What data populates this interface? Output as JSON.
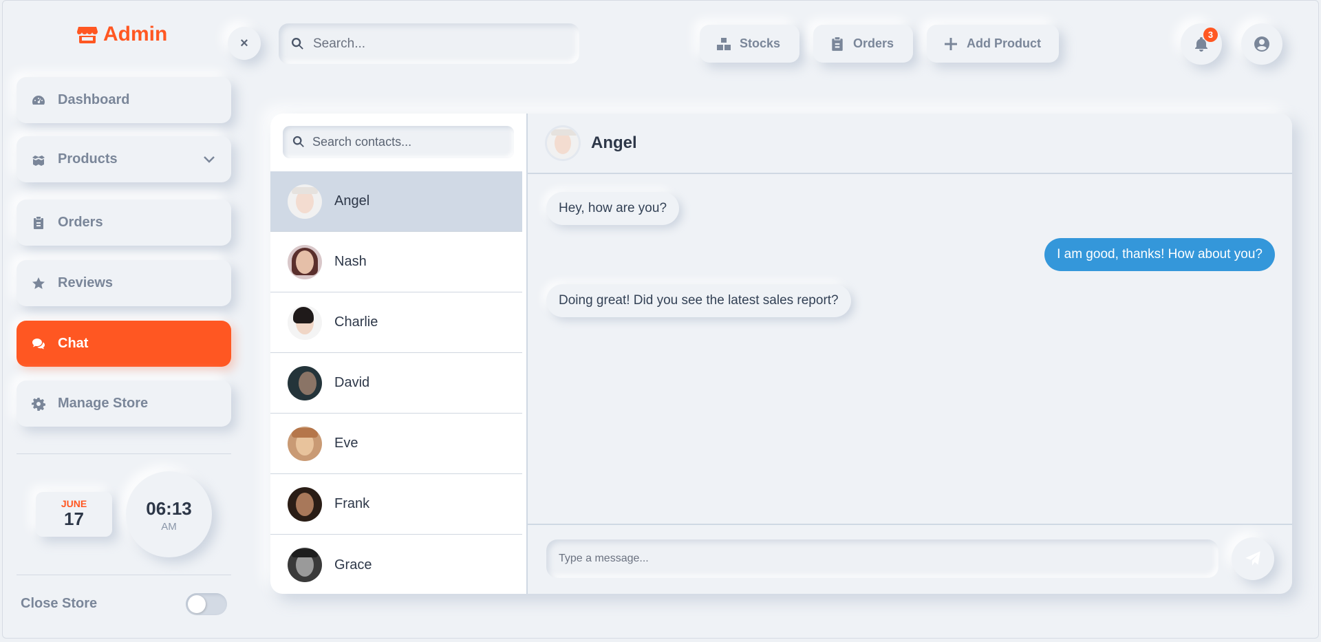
{
  "brand": {
    "name": "Admin",
    "icon": "store-icon",
    "color": "#ff5722"
  },
  "sidebar": {
    "items": [
      {
        "label": "Dashboard",
        "icon": "gauge-icon"
      },
      {
        "label": "Products",
        "icon": "boxes-icon"
      },
      {
        "label": "Orders",
        "icon": "clipboard-icon"
      },
      {
        "label": "Reviews",
        "icon": "star-icon"
      },
      {
        "label": "Chat",
        "icon": "comments-icon",
        "active": true
      },
      {
        "label": "Manage Store",
        "icon": "gear-icon"
      }
    ],
    "date": {
      "month": "JUNE",
      "day": "17"
    },
    "clock": {
      "time": "06:13",
      "ampm": "AM"
    },
    "close_store_label": "Close Store",
    "close_store_on": false
  },
  "header": {
    "close_label": "×",
    "search_placeholder": "Search...",
    "buttons": [
      {
        "label": "Stocks",
        "icon": "cubes-icon"
      },
      {
        "label": "Orders",
        "icon": "clipboard-icon"
      },
      {
        "label": "Add Product",
        "icon": "plus-icon"
      }
    ],
    "notifications_count": "3",
    "user_icon": "user-circle-icon"
  },
  "contacts": {
    "search_placeholder": "Search contacts...",
    "list": [
      {
        "name": "Angel",
        "active": true
      },
      {
        "name": "Nash"
      },
      {
        "name": "Charlie"
      },
      {
        "name": "David"
      },
      {
        "name": "Eve"
      },
      {
        "name": "Frank"
      },
      {
        "name": "Grace"
      }
    ]
  },
  "conversation": {
    "contact_name": "Angel",
    "messages": [
      {
        "text": "Hey, how are you?",
        "direction": "in"
      },
      {
        "text": "I am good, thanks! How about you?",
        "direction": "out"
      },
      {
        "text": "Doing great! Did you see the latest sales report?",
        "direction": "in"
      }
    ],
    "input_placeholder": "Type a message...",
    "send_icon": "paper-plane-icon"
  },
  "colors": {
    "accent": "#ff5722",
    "outgoing_bubble": "#3497da",
    "active_contact_bg": "#d0d9e5"
  }
}
